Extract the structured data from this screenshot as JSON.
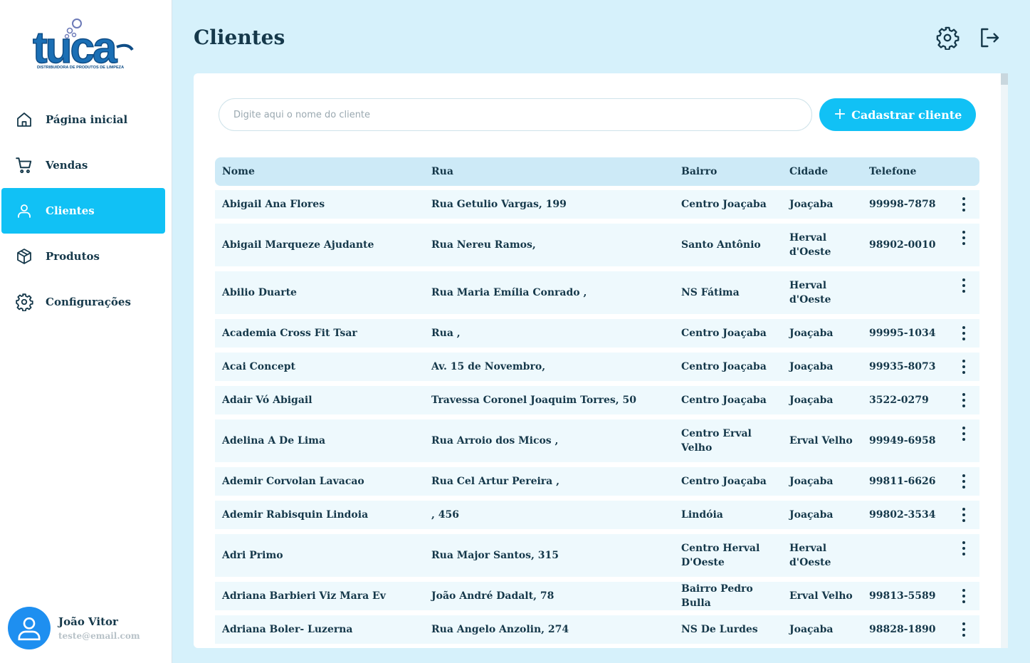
{
  "brand": {
    "logo_text": "tuca",
    "logo_tagline": "DISTRIBUIDORA DE PRODUTOS DE LIMPEZA",
    "colors": {
      "primary": "#11c1f5",
      "background": "#d6f1fb",
      "text": "#15384a"
    }
  },
  "sidebar": {
    "items": [
      {
        "label": "Página inicial",
        "icon": "home-icon"
      },
      {
        "label": "Vendas",
        "icon": "cart-icon"
      },
      {
        "label": "Clientes",
        "icon": "user-icon",
        "active": true
      },
      {
        "label": "Produtos",
        "icon": "box-icon"
      },
      {
        "label": "Configurações",
        "icon": "gear-icon"
      }
    ]
  },
  "user": {
    "name": "João Vitor",
    "email": "teste@email.com"
  },
  "header": {
    "title": "Clientes",
    "icons": [
      "settings-icon",
      "logout-icon"
    ]
  },
  "search": {
    "placeholder": "Digite aqui o nome do cliente",
    "value": ""
  },
  "add_button": {
    "label": "Cadastrar cliente",
    "icon": "plus-icon"
  },
  "table": {
    "columns": [
      "Nome",
      "Rua",
      "Bairro",
      "Cidade",
      "Telefone"
    ],
    "rows": [
      {
        "nome": "Abigail Ana Flores",
        "rua": "Rua Getulio Vargas, 199",
        "bairro": "Centro Joaçaba",
        "cidade": "Joaçaba",
        "telefone": "99998-7878"
      },
      {
        "nome": "Abigail Marqueze Ajudante",
        "rua": "Rua Nereu Ramos,",
        "bairro": "Santo Antônio",
        "cidade": "Herval\nd'Oeste",
        "telefone": "98902-0010"
      },
      {
        "nome": "Abilio Duarte",
        "rua": "Rua Maria Emília Conrado ,",
        "bairro": "NS Fátima",
        "cidade": "Herval\nd'Oeste",
        "telefone": ""
      },
      {
        "nome": "Academia Cross Fit Tsar",
        "rua": "Rua ,",
        "bairro": "Centro Joaçaba",
        "cidade": "Joaçaba",
        "telefone": "99995-1034"
      },
      {
        "nome": "Acai Concept",
        "rua": "Av. 15 de Novembro,",
        "bairro": "Centro Joaçaba",
        "cidade": "Joaçaba",
        "telefone": "99935-8073"
      },
      {
        "nome": "Adair Vó Abigail",
        "rua": "Travessa Coronel Joaquim Torres, 50",
        "bairro": "Centro Joaçaba",
        "cidade": "Joaçaba",
        "telefone": "3522-0279"
      },
      {
        "nome": "Adelina A De Lima",
        "rua": "Rua Arroio dos Micos ,",
        "bairro": "Centro Erval\nVelho",
        "cidade": "Erval Velho",
        "telefone": "99949-6958"
      },
      {
        "nome": "Ademir Corvolan Lavacao",
        "rua": "Rua Cel Artur Pereira ,",
        "bairro": "Centro Joaçaba",
        "cidade": "Joaçaba",
        "telefone": "99811-6626"
      },
      {
        "nome": "Ademir Rabisquin Lindoia",
        "rua": ", 456",
        "bairro": "Lindóia",
        "cidade": "Joaçaba",
        "telefone": "99802-3534"
      },
      {
        "nome": "Adri Primo",
        "rua": "Rua Major Santos, 315",
        "bairro": "Centro Herval\nD'Oeste",
        "cidade": "Herval\nd'Oeste",
        "telefone": ""
      },
      {
        "nome": "Adriana Barbieri Viz Mara Ev",
        "rua": "João André Dadalt, 78",
        "bairro": "Bairro Pedro Bulla",
        "cidade": "Erval Velho",
        "telefone": "99813-5589"
      },
      {
        "nome": "Adriana Boler- Luzerna",
        "rua": "Rua Angelo Anzolin, 274",
        "bairro": "NS De Lurdes",
        "cidade": "Joaçaba",
        "telefone": "98828-1890"
      }
    ]
  }
}
